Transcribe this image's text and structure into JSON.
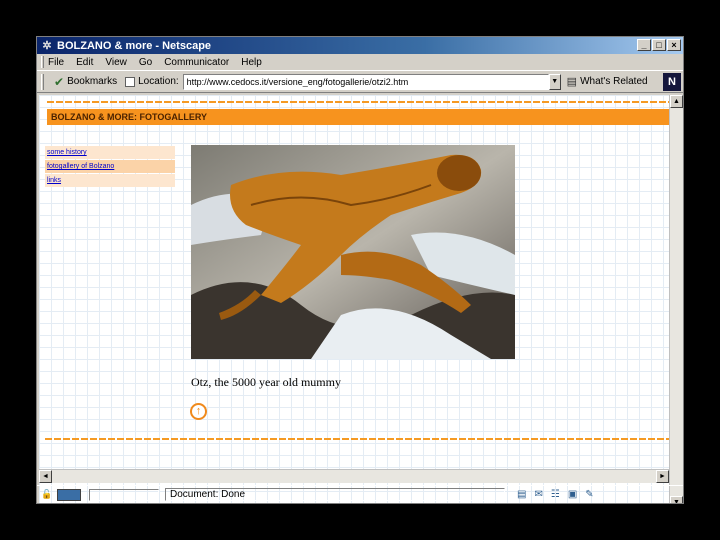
{
  "window": {
    "title": "BOLZANO & more - Netscape",
    "buttons": [
      "_",
      "□",
      "×"
    ]
  },
  "menubar": {
    "items": [
      "File",
      "Edit",
      "View",
      "Go",
      "Communicator",
      "Help"
    ]
  },
  "location_bar": {
    "bookmarks_label": "Bookmarks",
    "location_label": "Location:",
    "url": "http://www.cedocs.it/versione_eng/fotogallerie/otzi2.htm",
    "related_label": "What's Related"
  },
  "page": {
    "header": "BOLZANO & MORE: FOTOGALLERY",
    "nav": [
      {
        "label": "some history"
      },
      {
        "label": "fotogallery of Bolzano"
      },
      {
        "label": "links"
      }
    ],
    "caption": "Otz, the 5000 year old mummy",
    "arrow_glyph": "↑"
  },
  "statusbar": {
    "text": "Document: Done"
  },
  "colors": {
    "accent": "#f7931e",
    "titlebar": "#0a246a"
  }
}
